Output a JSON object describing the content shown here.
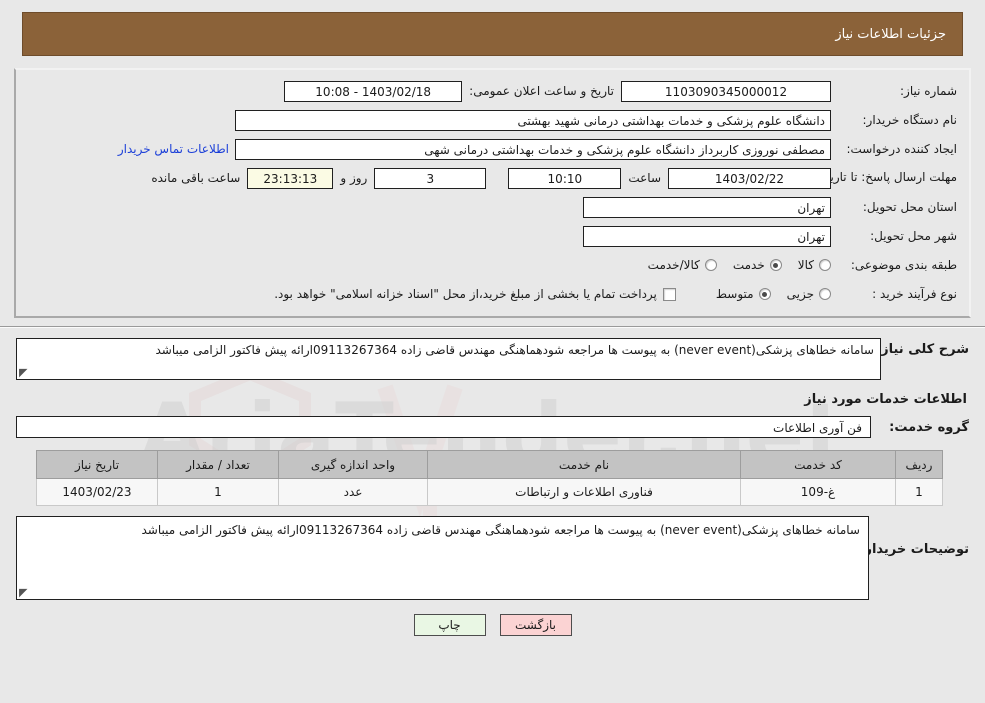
{
  "header": {
    "title": "جزئیات اطلاعات نیاز"
  },
  "info": {
    "need_no_label": "شماره نیاز:",
    "need_no_value": "1103090345000012",
    "announce_label": "تاریخ و ساعت اعلان عمومی:",
    "announce_value": "1403/02/18 - 10:08",
    "buyer_org_label": "نام دستگاه خریدار:",
    "buyer_org_value": "دانشگاه علوم پزشکی و خدمات بهداشتی درمانی شهید بهشتی",
    "creator_label": "ایجاد کننده درخواست:",
    "creator_value": "مصطفی نوروزی کاربرداز دانشگاه علوم پزشکی و خدمات بهداشتی درمانی شهی",
    "contact_link": "اطلاعات تماس خریدار",
    "deadline_label": "مهلت ارسال پاسخ: تا تاریخ:",
    "deadline_date": "1403/02/22",
    "deadline_time_label": "ساعت",
    "deadline_time": "10:10",
    "remaining_days": "3",
    "remaining_days_label": "روز و",
    "remaining_countdown": "23:13:13",
    "remaining_countdown_label": "ساعت باقی مانده",
    "province_label": "استان محل تحویل:",
    "province_value": "تهران",
    "city_label": "شهر محل تحویل:",
    "city_value": "تهران",
    "category_label": "طبقه بندی موضوعی:",
    "category_options": [
      {
        "label": "کالا",
        "selected": false
      },
      {
        "label": "خدمت",
        "selected": true
      },
      {
        "label": "کالا/خدمت",
        "selected": false
      }
    ],
    "process_label": "نوع فرآیند خرید :",
    "process_options": [
      {
        "label": "جزیی",
        "selected": false
      },
      {
        "label": "متوسط",
        "selected": true
      }
    ],
    "treasury_checkbox_text": "پرداخت تمام یا بخشی از مبلغ خرید،از محل \"اسناد خزانه اسلامی\" خواهد بود.",
    "treasury_checked": false
  },
  "description": {
    "label": "شرح کلی نیاز:",
    "value": "سامانه خطاهای پزشکی(never event) به پیوست ها مراجعه شودهماهنگی مهندس قاضی زاده 09113267364ارائه پیش فاکتور الزامی میباشد"
  },
  "services": {
    "section_title": "اطلاعات خدمات مورد نیاز",
    "group_label": "گروه خدمت:",
    "group_value": "فن آوری اطلاعات",
    "columns": [
      "ردیف",
      "کد خدمت",
      "نام خدمت",
      "واحد اندازه گیری",
      "تعداد / مقدار",
      "تاریخ نیاز"
    ],
    "rows": [
      {
        "index": "1",
        "code": "غ-109",
        "name": "فناوری اطلاعات و ارتباطات",
        "unit": "عدد",
        "qty": "1",
        "date": "1403/02/23"
      }
    ]
  },
  "remarks": {
    "label": "توضیحات خریدار:",
    "value": "سامانه خطاهای پزشکی(never event) به پیوست ها مراجعه شودهماهنگی مهندس قاضی زاده 09113267364ارائه پیش فاکتور الزامی میباشد"
  },
  "footer": {
    "back_label": "بازگشت",
    "print_label": "چاپ"
  },
  "watermark": {
    "text": "AriaTender.net"
  },
  "colors": {
    "title_bar": "#8b6239",
    "page_bg": "#e8e8e8",
    "link": "#1b3fd8",
    "countdown_bg": "#fbfbe4",
    "back_button": "#fbd3d3",
    "print_button": "#e9f7e4",
    "table_header": "#c3c3c3"
  }
}
